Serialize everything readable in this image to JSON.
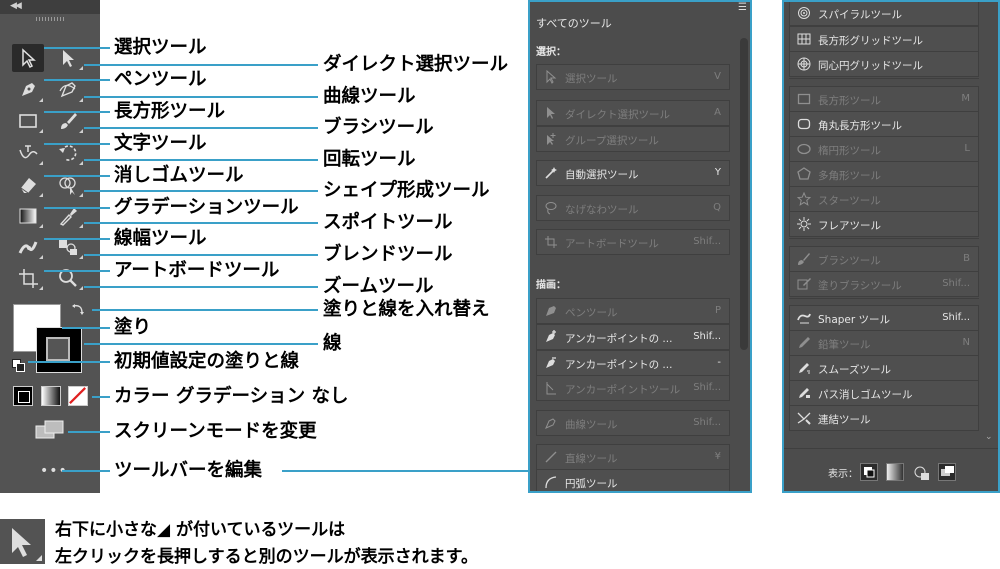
{
  "toolbar": {
    "collapse_icon": "double-chevron-left-icon"
  },
  "callouts_left": [
    {
      "text": "選択ツール"
    },
    {
      "text": "ペンツール"
    },
    {
      "text": "長方形ツール"
    },
    {
      "text": "文字ツール"
    },
    {
      "text": "消しゴムツール"
    },
    {
      "text": "グラデーションツール"
    },
    {
      "text": "線幅ツール"
    },
    {
      "text": "アートボードツール"
    },
    {
      "text": "塗り"
    },
    {
      "text": "初期値設定の塗りと線"
    },
    {
      "text": "カラー グラデーション なし"
    },
    {
      "text": "スクリーンモードを変更"
    },
    {
      "text": "ツールバーを編集"
    }
  ],
  "callouts_right": [
    {
      "text": "ダイレクト選択ツール"
    },
    {
      "text": "曲線ツール"
    },
    {
      "text": "ブラシツール"
    },
    {
      "text": "回転ツール"
    },
    {
      "text": "シェイプ形成ツール"
    },
    {
      "text": "スポイトツール"
    },
    {
      "text": "ブレンドツール"
    },
    {
      "text": "ズームツール"
    },
    {
      "text": "塗りと線を入れ替え"
    },
    {
      "text": "線"
    }
  ],
  "panel1": {
    "title": "すべてのツール",
    "menu_icon": "panel-menu-icon",
    "section_select": "選択：",
    "section_draw": "描画：",
    "rows": [
      {
        "label": "選択ツール",
        "key": "V",
        "dim": true
      },
      {
        "label": "ダイレクト選択ツール",
        "key": "A",
        "dim": true
      },
      {
        "label": "グループ選択ツール",
        "key": "",
        "dim": true
      },
      {
        "label": "自動選択ツール",
        "key": "Y",
        "dim": false
      },
      {
        "label": "なげなわツール",
        "key": "Q",
        "dim": true
      },
      {
        "label": "アートボードツール",
        "key": "Shif...",
        "dim": true
      },
      {
        "label": "ペンツール",
        "key": "P",
        "dim": true
      },
      {
        "label": "アンカーポイントの ...",
        "key": "Shif...",
        "dim": false
      },
      {
        "label": "アンカーポイントの ...",
        "key": "-",
        "dim": false
      },
      {
        "label": "アンカーポイントツール",
        "key": "Shif...",
        "dim": true
      },
      {
        "label": "曲線ツール",
        "key": "Shif...",
        "dim": true
      },
      {
        "label": "直線ツール",
        "key": "¥",
        "dim": true
      },
      {
        "label": "円弧ツール",
        "key": "",
        "dim": false
      }
    ]
  },
  "panel2": {
    "rows": [
      {
        "label": "スパイラルツール",
        "key": "",
        "dim": false
      },
      {
        "label": "長方形グリッドツール",
        "key": "",
        "dim": false
      },
      {
        "label": "同心円グリッドツール",
        "key": "",
        "dim": false
      },
      {
        "label": "長方形ツール",
        "key": "M",
        "dim": true
      },
      {
        "label": "角丸長方形ツール",
        "key": "",
        "dim": false
      },
      {
        "label": "楕円形ツール",
        "key": "L",
        "dim": true
      },
      {
        "label": "多角形ツール",
        "key": "",
        "dim": true
      },
      {
        "label": "スターツール",
        "key": "",
        "dim": true
      },
      {
        "label": "フレアツール",
        "key": "",
        "dim": false
      },
      {
        "label": "ブラシツール",
        "key": "B",
        "dim": true
      },
      {
        "label": "塗りブラシツール",
        "key": "Shif...",
        "dim": true
      },
      {
        "label": "Shaper ツール",
        "key": "Shif...",
        "dim": false
      },
      {
        "label": "鉛筆ツール",
        "key": "N",
        "dim": true
      },
      {
        "label": "スムーズツール",
        "key": "",
        "dim": false
      },
      {
        "label": "パス消しゴムツール",
        "key": "",
        "dim": false
      },
      {
        "label": "連結ツール",
        "key": "",
        "dim": false
      }
    ],
    "footer_label": "表示："
  },
  "note": {
    "line1": "右下に小さな◢ が付いているツールは",
    "line2": "左クリックを長押しすると別のツールが表示されます。"
  },
  "colors": {
    "accent": "#3aa0c8",
    "panel": "#4c4c4c",
    "toolbar": "#535353"
  }
}
